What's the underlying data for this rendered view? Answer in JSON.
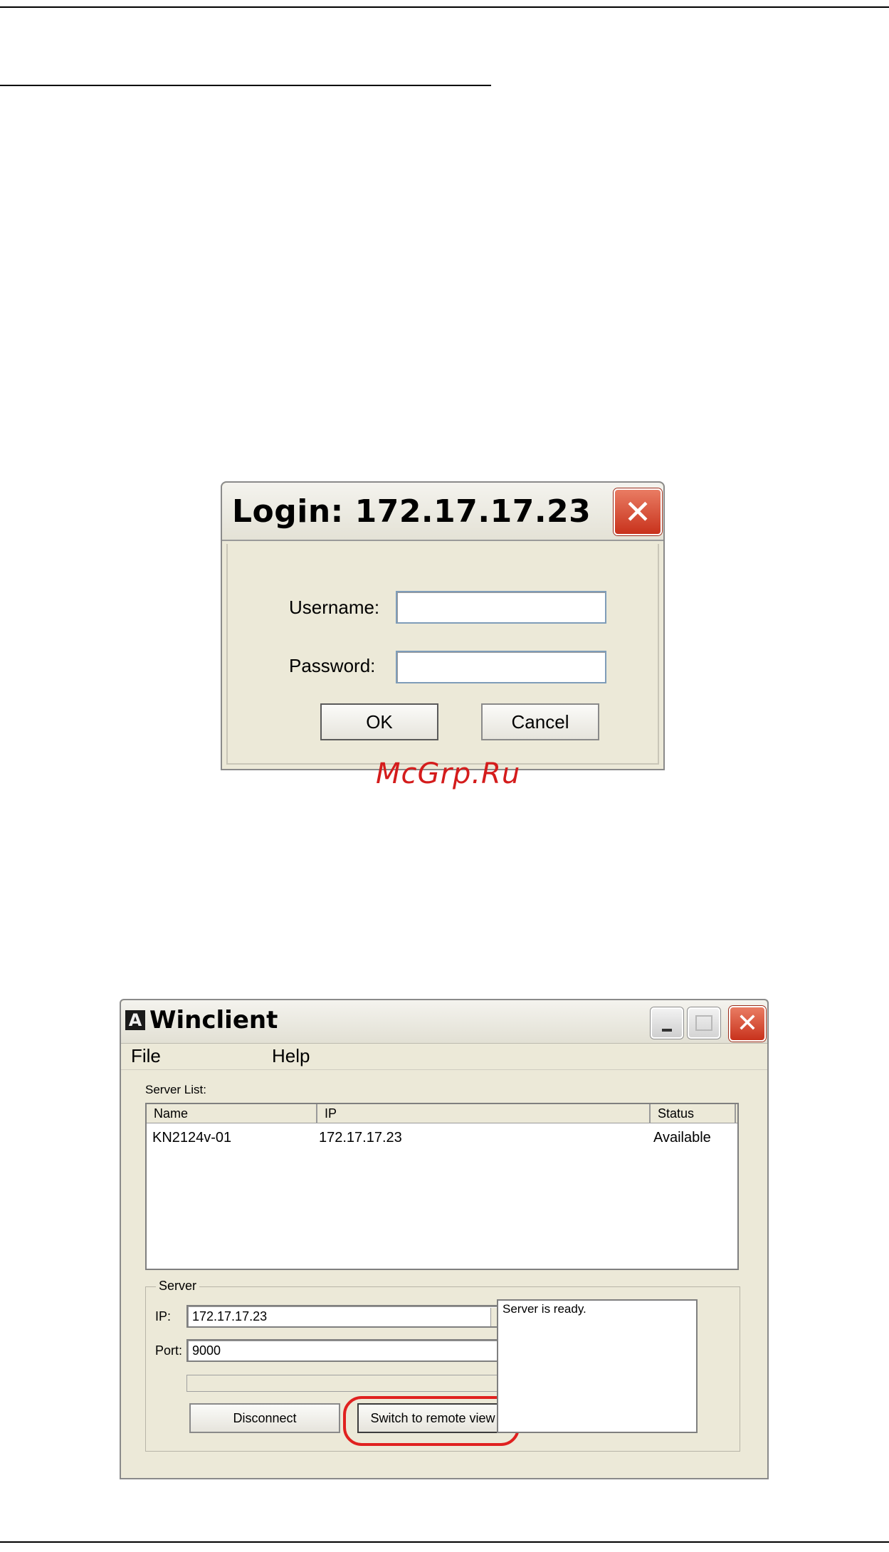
{
  "login_dialog": {
    "title": "Login: 172.17.17.23",
    "username_label": "Username:",
    "username_value": "",
    "password_label": "Password:",
    "password_value": "",
    "ok_label": "OK",
    "cancel_label": "Cancel"
  },
  "watermark": "McGrp.Ru",
  "winclient": {
    "app_icon": "A",
    "title": "Winclient",
    "menu": [
      "File",
      "Help"
    ],
    "server_list_label": "Server List:",
    "columns": [
      "Name",
      "IP",
      "Status"
    ],
    "rows": [
      {
        "name": "KN2124v-01",
        "ip": "172.17.17.23",
        "status": "Available"
      }
    ],
    "server_group_label": "Server",
    "ip_label": "IP:",
    "ip_value": "172.17.17.23",
    "port_label": "Port:",
    "port_value": "9000",
    "disconnect_label": "Disconnect",
    "switch_label": "Switch to remote view",
    "status_message": "Server is ready."
  },
  "colors": {
    "dialog_face": "#ece9d8",
    "close_red": "#c8321c",
    "highlight_ring": "#e0211f",
    "watermark": "#d41c1c"
  },
  "icons": {
    "close": "close-icon",
    "minimize": "minimize-icon",
    "maximize": "maximize-icon",
    "dropdown": "chevron-down-icon"
  }
}
